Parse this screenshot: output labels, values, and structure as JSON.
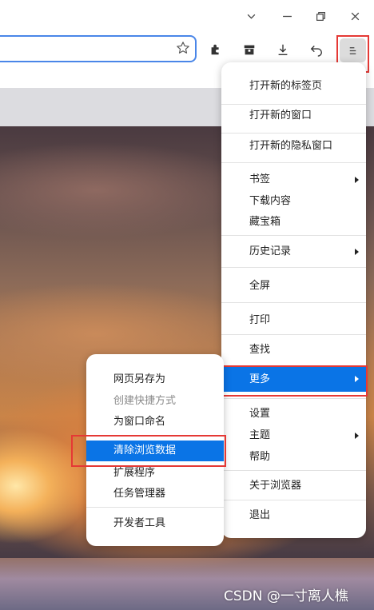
{
  "menu": {
    "items": [
      {
        "label": "打开新的标签页"
      },
      {
        "label": "打开新的窗口"
      },
      {
        "label": "打开新的隐私窗口"
      },
      {
        "label": "书签"
      },
      {
        "label": "下载内容"
      },
      {
        "label": "藏宝箱"
      },
      {
        "label": "历史记录"
      },
      {
        "label": "全屏"
      },
      {
        "label": "打印"
      },
      {
        "label": "查找"
      },
      {
        "label": "更多"
      },
      {
        "label": "设置"
      },
      {
        "label": "主题"
      },
      {
        "label": "帮助"
      },
      {
        "label": "关于浏览器"
      },
      {
        "label": "退出"
      }
    ]
  },
  "submenu": {
    "items": [
      {
        "label": "网页另存为"
      },
      {
        "label": "创建快捷方式",
        "disabled": true
      },
      {
        "label": "为窗口命名"
      },
      {
        "label": "清除浏览数据"
      },
      {
        "label": "扩展程序"
      },
      {
        "label": "任务管理器"
      },
      {
        "label": "开发者工具"
      }
    ]
  },
  "watermark": "CSDN @一寸离人樵",
  "colors": {
    "highlight": "#0a74e6",
    "annotation": "#e53935"
  }
}
